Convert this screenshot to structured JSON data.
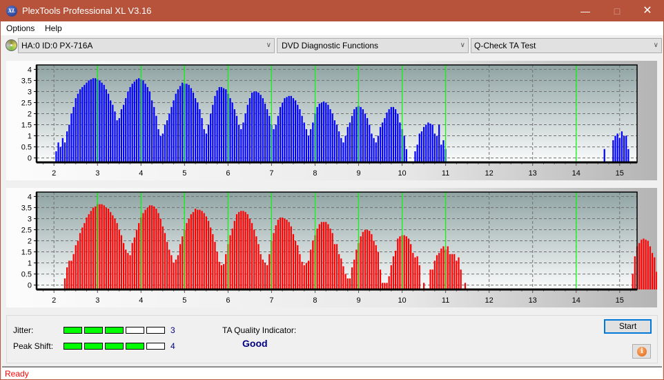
{
  "window": {
    "title": "PlexTools Professional XL V3.16",
    "app_icon_text": "XL",
    "minimize": "—",
    "maximize": "□",
    "close": "✕"
  },
  "menu": {
    "items": [
      "Options",
      "Help"
    ]
  },
  "toolbar": {
    "drive": "HA:0 ID:0  PX-716A",
    "function": "DVD Diagnostic Functions",
    "test": "Q-Check TA Test",
    "chevron": "∨"
  },
  "colors": {
    "title_bar": "#b6533a",
    "series1": "#0000ff",
    "series2": "#ff0000",
    "peak_marker": "#00ff00",
    "meter_on": "#00ff00",
    "indicator_text": "#000080",
    "status_text": "#ff0000"
  },
  "chart_data": [
    {
      "type": "bar",
      "title": "",
      "xlabel": "",
      "ylabel": "",
      "xlim": [
        1.6,
        15.4
      ],
      "ylim": [
        -0.2,
        4.2
      ],
      "x_ticks": [
        2,
        3,
        4,
        5,
        6,
        7,
        8,
        9,
        10,
        11,
        12,
        13,
        14,
        15
      ],
      "y_ticks": [
        0,
        0.5,
        1,
        1.5,
        2,
        2.5,
        3,
        3.5,
        4
      ],
      "y_tick_labels": [
        "0",
        "0.5",
        "1",
        "1.5",
        "2",
        "2.5",
        "3",
        "3.5",
        "4"
      ],
      "grid": true,
      "peak_markers": [
        3,
        4,
        5,
        6,
        7,
        8,
        9,
        10,
        11,
        14
      ],
      "bin_width": 0.05,
      "x_start": 1.95,
      "series": [
        {
          "name": "lands",
          "color": "#0000ff",
          "values": [
            0,
            0,
            0.3,
            0.7,
            0.5,
            0.9,
            0.7,
            1.2,
            1.5,
            2.0,
            2.3,
            2.7,
            2.9,
            3.1,
            3.2,
            3.3,
            3.4,
            3.5,
            3.55,
            3.6,
            3.6,
            3.55,
            3.5,
            3.4,
            3.3,
            3.1,
            2.9,
            2.6,
            2.4,
            2.1,
            1.7,
            1.8,
            2.2,
            2.4,
            2.7,
            3.0,
            3.2,
            3.35,
            3.45,
            3.55,
            3.6,
            3.55,
            3.5,
            3.35,
            3.2,
            3.0,
            2.6,
            2.3,
            1.9,
            1.3,
            1.0,
            1.1,
            1.5,
            1.7,
            2.0,
            2.3,
            2.6,
            2.9,
            3.1,
            3.25,
            3.4,
            3.35,
            3.35,
            3.3,
            3.15,
            2.95,
            2.7,
            2.5,
            2.2,
            1.8,
            1.3,
            1.1,
            1.5,
            2.0,
            2.4,
            2.8,
            3.05,
            3.2,
            3.2,
            3.15,
            3.1,
            2.9,
            2.7,
            2.5,
            2.2,
            1.9,
            1.5,
            1.3,
            1.6,
            2.0,
            2.4,
            2.7,
            2.95,
            3.0,
            3.0,
            2.95,
            2.85,
            2.7,
            2.45,
            2.2,
            1.9,
            1.5,
            1.3,
            1.5,
            1.9,
            2.3,
            2.5,
            2.7,
            2.75,
            2.8,
            2.8,
            2.7,
            2.6,
            2.4,
            2.2,
            1.9,
            1.6,
            1.3,
            1.0,
            1.3,
            1.6,
            2.0,
            2.3,
            2.45,
            2.5,
            2.55,
            2.5,
            2.4,
            2.2,
            2.0,
            1.7,
            1.5,
            1.2,
            0.9,
            0.7,
            1.0,
            1.4,
            1.6,
            1.9,
            2.2,
            2.3,
            2.35,
            2.3,
            2.2,
            2.0,
            1.8,
            1.5,
            1.1,
            0.9,
            0.7,
            1.0,
            1.4,
            1.6,
            1.8,
            2.05,
            2.2,
            2.3,
            2.3,
            2.2,
            2.0,
            1.6,
            1.3,
            1.0,
            0.4,
            0,
            0,
            0,
            0.3,
            0.6,
            1.1,
            1.2,
            1.4,
            1.5,
            1.6,
            1.55,
            1.5,
            1.1,
            1.0,
            1.5,
            0.6,
            0.8,
            0.4,
            0,
            0,
            0,
            0,
            0,
            0,
            0,
            0,
            0,
            0,
            0,
            0,
            0,
            0,
            0,
            0,
            0,
            0,
            0,
            0,
            0,
            0,
            0,
            0,
            0,
            0,
            0,
            0,
            0,
            0,
            0,
            0,
            0,
            0,
            0,
            0,
            0,
            0,
            0,
            0,
            0,
            0,
            0,
            0,
            0,
            0,
            0,
            0,
            0,
            0,
            0,
            0,
            0,
            0,
            0,
            0,
            0,
            0,
            0,
            0,
            0,
            0,
            0,
            0,
            0,
            0,
            0,
            0,
            0,
            0,
            0,
            0,
            0.4,
            0,
            0,
            0,
            0.8,
            1.0,
            1.1,
            0.9,
            1.2,
            1.0,
            1.0,
            0.4,
            0
          ]
        }
      ]
    },
    {
      "type": "bar",
      "title": "",
      "xlabel": "",
      "ylabel": "",
      "xlim": [
        1.6,
        15.4
      ],
      "ylim": [
        -0.2,
        4.2
      ],
      "x_ticks": [
        2,
        3,
        4,
        5,
        6,
        7,
        8,
        9,
        10,
        11,
        12,
        13,
        14,
        15
      ],
      "y_ticks": [
        0,
        0.5,
        1,
        1.5,
        2,
        2.5,
        3,
        3.5,
        4
      ],
      "y_tick_labels": [
        "0",
        "0.5",
        "1",
        "1.5",
        "2",
        "2.5",
        "3",
        "3.5",
        "4"
      ],
      "grid": true,
      "peak_markers": [
        3,
        4,
        5,
        6,
        7,
        8,
        9,
        10,
        11,
        14
      ],
      "bin_width": 0.05,
      "x_start": 1.95,
      "series": [
        {
          "name": "pits",
          "color": "#ff0000",
          "values": [
            0,
            0,
            0,
            0,
            0,
            0,
            0.3,
            0.8,
            1.1,
            1.1,
            1.4,
            1.8,
            2.0,
            2.35,
            2.6,
            2.8,
            3.05,
            3.2,
            3.35,
            3.5,
            3.55,
            3.65,
            3.65,
            3.65,
            3.6,
            3.5,
            3.45,
            3.3,
            3.15,
            3.0,
            2.8,
            2.5,
            2.25,
            1.9,
            1.6,
            1.45,
            1.35,
            1.9,
            2.15,
            2.5,
            2.8,
            3.05,
            3.25,
            3.4,
            3.5,
            3.6,
            3.6,
            3.55,
            3.45,
            3.25,
            3.0,
            2.65,
            2.35,
            1.95,
            1.6,
            1.35,
            1.0,
            1.15,
            1.35,
            1.85,
            2.2,
            2.5,
            2.8,
            3.0,
            3.2,
            3.3,
            3.45,
            3.4,
            3.4,
            3.35,
            3.25,
            3.1,
            2.9,
            2.6,
            2.3,
            1.95,
            1.5,
            1.05,
            0.9,
            0.95,
            1.4,
            1.85,
            2.25,
            2.55,
            2.9,
            3.2,
            3.3,
            3.35,
            3.35,
            3.3,
            3.2,
            3.0,
            2.8,
            2.5,
            2.2,
            1.85,
            1.4,
            1.15,
            1.0,
            0.9,
            1.4,
            2.0,
            2.35,
            2.7,
            2.95,
            3.05,
            3.05,
            3.0,
            2.95,
            2.85,
            2.65,
            2.3,
            2.0,
            1.8,
            1.4,
            1.05,
            0.9,
            1.0,
            1.1,
            1.6,
            2.0,
            2.25,
            2.55,
            2.75,
            2.85,
            2.85,
            2.85,
            2.75,
            2.55,
            2.35,
            1.85,
            1.85,
            1.4,
            1.2,
            0.85,
            0.5,
            0.3,
            0.3,
            0.8,
            1.15,
            1.6,
            1.9,
            2.2,
            2.4,
            2.5,
            2.5,
            2.45,
            2.3,
            2.0,
            1.8,
            1.5,
            0.7,
            0.1,
            0.1,
            0.1,
            0.4,
            0.9,
            1.3,
            1.55,
            2.1,
            2.2,
            2.25,
            2.25,
            2.2,
            2.1,
            1.85,
            1.45,
            1.25,
            1.3,
            0.9,
            0,
            0.1,
            0,
            0,
            0.7,
            0.7,
            1.1,
            1.35,
            1.45,
            1.65,
            1.75,
            1.6,
            1.75,
            1.4,
            1.4,
            1.4,
            1.1,
            1.25,
            0.7,
            0,
            0.1,
            0,
            0,
            0,
            0,
            0,
            0,
            0,
            0,
            0,
            0,
            0,
            0,
            0,
            0,
            0,
            0,
            0,
            0,
            0,
            0,
            0,
            0,
            0,
            0,
            0,
            0,
            0,
            0,
            0,
            0,
            0,
            0,
            0,
            0,
            0,
            0,
            0,
            0,
            0,
            0,
            0,
            0,
            0,
            0,
            0,
            0,
            0,
            0,
            0,
            0,
            0,
            0,
            0,
            0,
            0,
            0,
            0,
            0,
            0,
            0,
            0,
            0,
            0,
            0,
            0,
            0,
            0,
            0,
            0,
            0,
            0,
            0,
            0,
            0,
            0,
            0,
            0.5,
            1.3,
            1.75,
            1.9,
            2.05,
            2.1,
            2.05,
            2.0,
            1.75,
            1.45,
            1.25,
            0.6
          ]
        }
      ]
    }
  ],
  "meters": {
    "jitter": {
      "label": "Jitter:",
      "value": "3",
      "filled": 3,
      "total": 5
    },
    "peak_shift": {
      "label": "Peak Shift:",
      "value": "4",
      "filled": 4,
      "total": 5
    }
  },
  "ta_quality": {
    "label": "TA Quality Indicator:",
    "value": "Good"
  },
  "buttons": {
    "start": "Start",
    "info_icon": "i"
  },
  "status": {
    "text": "Ready"
  }
}
